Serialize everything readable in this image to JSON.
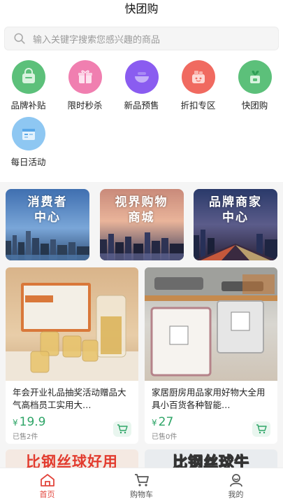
{
  "header": {
    "title": "快团购"
  },
  "search": {
    "placeholder": "输入关键字搜索您感兴趣的商品"
  },
  "categories": [
    {
      "label": "品牌补贴",
      "icon": "bag-icon",
      "color": "#5cc07a"
    },
    {
      "label": "限时秒杀",
      "icon": "gift-icon",
      "color": "#f07fb0"
    },
    {
      "label": "新品预售",
      "icon": "bowl-icon",
      "color": "#8a5cf0"
    },
    {
      "label": "折扣专区",
      "icon": "discount-basket-icon",
      "color": "#f06a60"
    },
    {
      "label": "快团购",
      "icon": "plant-bag-icon",
      "color": "#5cc07a"
    },
    {
      "label": "每日活动",
      "icon": "calendar-icon",
      "color": "#5aa8e8"
    }
  ],
  "banners": [
    {
      "title": "消费者\n中心",
      "line1": "消费者",
      "line2": "中心"
    },
    {
      "title": "视界购物\n商城",
      "line1": "视界购物",
      "line2": "商城"
    },
    {
      "title": "品牌商家\n中心",
      "line1": "品牌商家",
      "line2": "中心"
    }
  ],
  "products": [
    {
      "title": "年会开业礼品抽奖活动赠品大气高档员工实用大…",
      "currency": "¥",
      "price": "19.9",
      "sold": "已售2件"
    },
    {
      "title": "家居厨房用品家用好物大全用具小百货各种智能…",
      "currency": "¥",
      "price": "27",
      "sold": "已售0件"
    }
  ],
  "row2": [
    {
      "text": "比钢丝球好用"
    },
    {
      "text": "比钢丝球牛"
    }
  ],
  "tabs": [
    {
      "label": "首页",
      "icon": "home-icon",
      "active": true
    },
    {
      "label": "购物车",
      "icon": "cart-icon",
      "active": false
    },
    {
      "label": "我的",
      "icon": "user-icon",
      "active": false
    }
  ],
  "colors": {
    "accent": "#e2453c",
    "price": "#2ea567"
  }
}
